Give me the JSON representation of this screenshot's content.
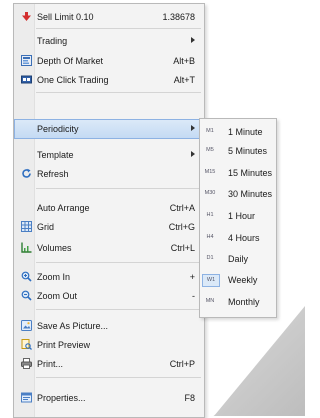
{
  "menu": {
    "items": [
      {
        "label": "Sell Limit 0.10",
        "value": "1.38678",
        "icon": "sell-arrow-icon"
      },
      {
        "label": "Trading",
        "submenu": true
      },
      {
        "label": "Depth Of Market",
        "shortcut": "Alt+B",
        "icon": "depth-of-market-icon"
      },
      {
        "label": "One Click Trading",
        "shortcut": "Alt+T",
        "icon": "one-click-trading-icon"
      },
      {
        "label": "Periodicity",
        "submenu": true
      },
      {
        "label": "Template",
        "submenu": true
      },
      {
        "label": "Refresh",
        "icon": "refresh-icon"
      },
      {
        "label": "Auto Arrange",
        "shortcut": "Ctrl+A"
      },
      {
        "label": "Grid",
        "shortcut": "Ctrl+G",
        "icon": "grid-icon"
      },
      {
        "label": "Volumes",
        "shortcut": "Ctrl+L",
        "icon": "volumes-icon"
      },
      {
        "label": "Zoom In",
        "shortcut": "+",
        "icon": "zoom-in-icon"
      },
      {
        "label": "Zoom Out",
        "shortcut": "-",
        "icon": "zoom-out-icon"
      },
      {
        "label": "Save As Picture...",
        "icon": "save-picture-icon"
      },
      {
        "label": "Print Preview",
        "icon": "print-preview-icon"
      },
      {
        "label": "Print...",
        "shortcut": "Ctrl+P",
        "icon": "print-icon"
      },
      {
        "label": "Properties...",
        "shortcut": "F8",
        "icon": "properties-icon"
      }
    ]
  },
  "periodicity": {
    "items": [
      {
        "code": "M1",
        "label": "1 Minute"
      },
      {
        "code": "M5",
        "label": "5 Minutes"
      },
      {
        "code": "M15",
        "label": "15 Minutes"
      },
      {
        "code": "M30",
        "label": "30 Minutes"
      },
      {
        "code": "H1",
        "label": "1 Hour"
      },
      {
        "code": "H4",
        "label": "4 Hours"
      },
      {
        "code": "D1",
        "label": "Daily"
      },
      {
        "code": "W1",
        "label": "Weekly",
        "selected": true
      },
      {
        "code": "MN",
        "label": "Monthly"
      }
    ]
  },
  "colors": {
    "highlight": "#c4daf3",
    "highlight_border": "#8db2e3",
    "sell": "#d32f2f"
  }
}
